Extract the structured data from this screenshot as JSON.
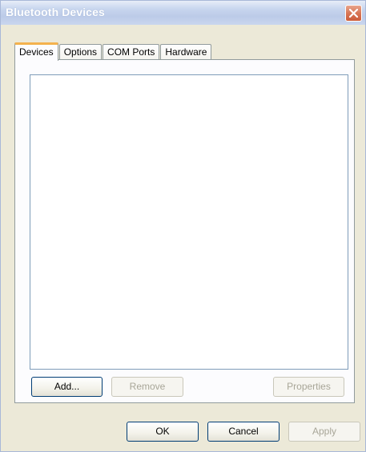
{
  "window": {
    "title": "Bluetooth Devices"
  },
  "tabs": [
    {
      "label": "Devices",
      "active": true
    },
    {
      "label": "Options",
      "active": false
    },
    {
      "label": "COM Ports",
      "active": false
    },
    {
      "label": "Hardware",
      "active": false
    }
  ],
  "devices_panel": {
    "add_label": "Add...",
    "remove_label": "Remove",
    "properties_label": "Properties"
  },
  "dialog_buttons": {
    "ok_label": "OK",
    "cancel_label": "Cancel",
    "apply_label": "Apply"
  },
  "colors": {
    "tab_highlight": "#f4b24d",
    "close_button": "#d77656"
  },
  "icons": {
    "close": "close-icon"
  }
}
